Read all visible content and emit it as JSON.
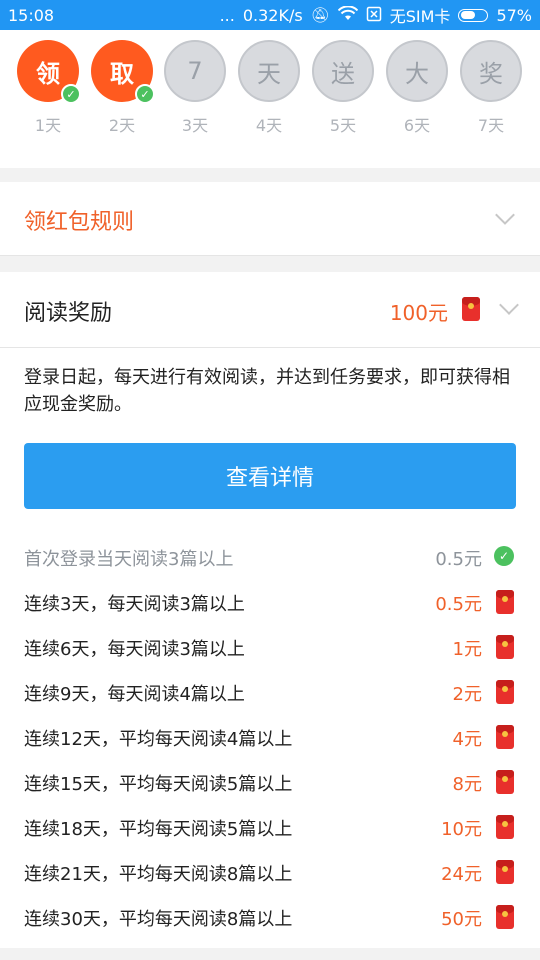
{
  "status_bar": {
    "time": "15:08",
    "dots": "...",
    "speed": "0.32K/s",
    "sim": "无SIM卡",
    "battery": "57%",
    "battery_level": 0.57
  },
  "days": [
    {
      "char": "领",
      "label": "1天",
      "state": "active",
      "checked": true
    },
    {
      "char": "取",
      "label": "2天",
      "state": "active",
      "checked": true
    },
    {
      "char": "7",
      "label": "3天",
      "state": "inactive",
      "checked": false
    },
    {
      "char": "天",
      "label": "4天",
      "state": "inactive",
      "checked": false
    },
    {
      "char": "送",
      "label": "5天",
      "state": "inactive",
      "checked": false
    },
    {
      "char": "大",
      "label": "6天",
      "state": "inactive",
      "checked": false
    },
    {
      "char": "奖",
      "label": "7天",
      "state": "inactive",
      "checked": false
    }
  ],
  "rules": {
    "title": "领红包规则"
  },
  "reward": {
    "title": "阅读奖励",
    "amount": "100元",
    "description": "登录日起，每天进行有效阅读，并达到任务要求，即可获得相应现金奖励。",
    "button_label": "查看详情"
  },
  "tasks": [
    {
      "label": "首次登录当天阅读3篇以上",
      "value": "0.5元",
      "done": true
    },
    {
      "label": "连续3天，每天阅读3篇以上",
      "value": "0.5元",
      "done": false
    },
    {
      "label": "连续6天，每天阅读3篇以上",
      "value": "1元",
      "done": false
    },
    {
      "label": "连续9天，每天阅读4篇以上",
      "value": "2元",
      "done": false
    },
    {
      "label": "连续12天，平均每天阅读4篇以上",
      "value": "4元",
      "done": false
    },
    {
      "label": "连续15天，平均每天阅读5篇以上",
      "value": "8元",
      "done": false
    },
    {
      "label": "连续18天，平均每天阅读5篇以上",
      "value": "10元",
      "done": false
    },
    {
      "label": "连续21天，平均每天阅读8篇以上",
      "value": "24元",
      "done": false
    },
    {
      "label": "连续30天，平均每天阅读8篇以上",
      "value": "50元",
      "done": false
    }
  ],
  "colors": {
    "accent": "#f0612a",
    "primary": "#2196f3",
    "check": "#4cc15f"
  }
}
